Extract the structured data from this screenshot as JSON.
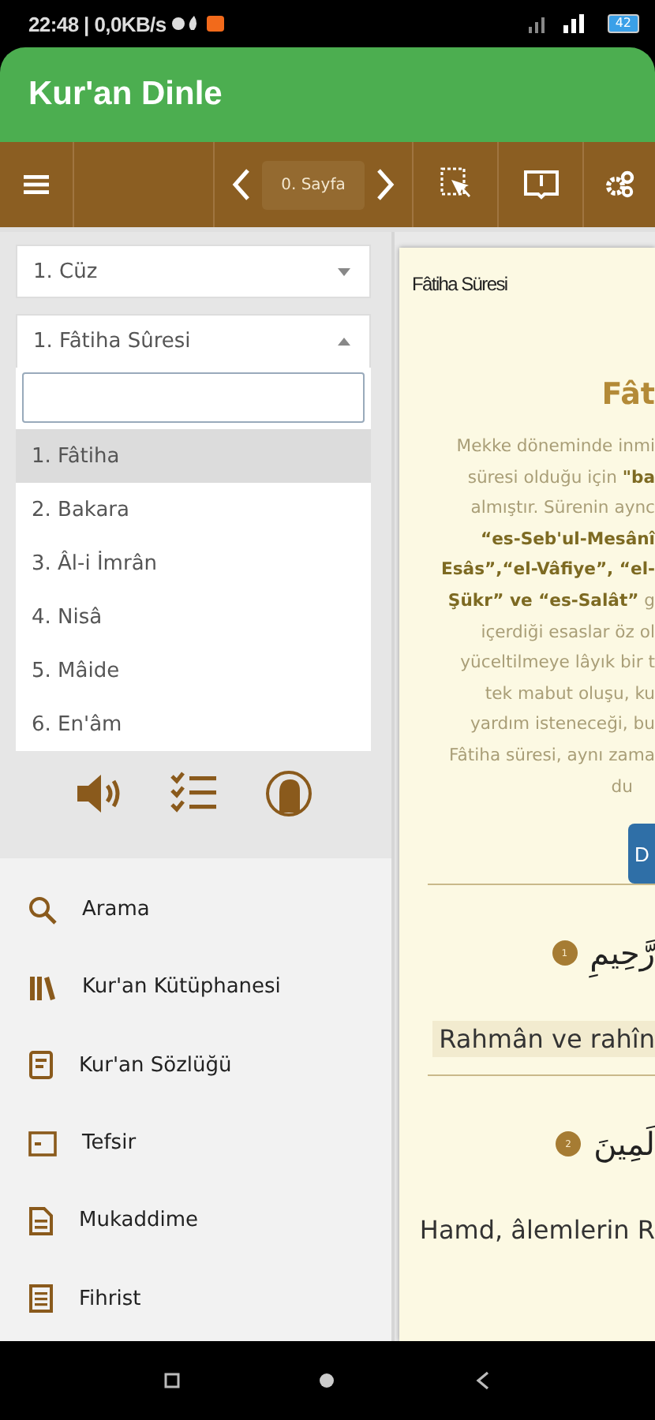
{
  "status_bar": {
    "left": "22:48 | 0,0KB/s",
    "battery": "42"
  },
  "app_bar": {
    "title": "Kur'an Dinle"
  },
  "toolbar": {
    "page": "0. Sayfa"
  },
  "juz_select": {
    "value": "1. Cüz",
    "expanded": false
  },
  "sura_select": {
    "value": "1. Fâtiha Sûresi",
    "expanded": true,
    "options": [
      {
        "label": "1. Fâtiha",
        "selected": true
      },
      {
        "label": "2. Bakara",
        "selected": false
      },
      {
        "label": "3. Âl-i İmrân",
        "selected": false
      },
      {
        "label": "4. Nisâ",
        "selected": false
      },
      {
        "label": "5. Mâide",
        "selected": false
      },
      {
        "label": "6. En'âm",
        "selected": false
      }
    ]
  },
  "menu": [
    {
      "label": "Arama",
      "kind": "search"
    },
    {
      "label": "Kur'an Kütüphanesi",
      "kind": "library"
    },
    {
      "label": "Kur'an Sözlüğü",
      "kind": "dictionary"
    },
    {
      "label": "Tefsir",
      "kind": "tafsir"
    },
    {
      "label": "Mukaddime",
      "kind": "intro"
    },
    {
      "label": "Fihrist",
      "kind": "index"
    }
  ],
  "reader": {
    "header": "Fâtiha Süresi",
    "title": "Fât",
    "intro_lines": [
      "Mekke döneminde inmi",
      "süresi olduğu için **\"ba**",
      "almıştır. Sürenin aync",
      "**“es-Seb'ul-Mesânî**",
      "**Esâs”,“el-Vâfiye”, “el-**",
      "**Şükr” ve “es-Salât”** g",
      "içerdiği esaslar öz ol",
      "yüceltilmeye lâyık bir t",
      "tek mabut oluşu, ku",
      "yardım isteneceği, bu",
      "Fâtiha süresi, aynı zama",
      "du"
    ],
    "button": "D",
    "verses": [
      {
        "number": "1",
        "arabic": "رَّحِيمِ",
        "translation": "Rahmân ve rahîn",
        "highlighted": true
      },
      {
        "number": "2",
        "arabic": "لَمِينَ",
        "translation": "Hamd, âlemlerin R",
        "highlighted": false
      }
    ]
  }
}
